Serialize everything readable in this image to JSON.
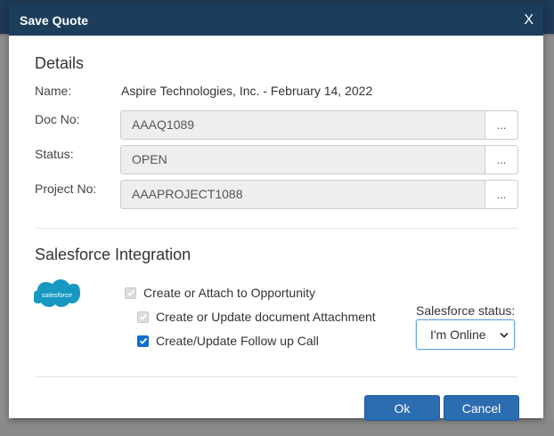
{
  "dialog": {
    "title": "Save Quote",
    "close_label": "X"
  },
  "details": {
    "heading": "Details",
    "name_label": "Name:",
    "name_value": "Aspire Technologies, Inc. - February 14, 2022",
    "doc_label": "Doc No:",
    "doc_value": "AAAQ1089",
    "status_label": "Status:",
    "status_value": "OPEN",
    "project_label": "Project No:",
    "project_value": "AAAPROJECT1088",
    "browse_label": "..."
  },
  "integration": {
    "heading": "Salesforce Integration",
    "logo_text": "salesforce",
    "options": [
      {
        "label": "Create or Attach to Opportunity",
        "checked": true,
        "disabled": true
      },
      {
        "label": "Create or Update document Attachment",
        "checked": true,
        "disabled": true
      },
      {
        "label": "Create/Update Follow up Call",
        "checked": true,
        "disabled": false
      }
    ],
    "status_label": "Salesforce status:",
    "status_selected": "I'm Online"
  },
  "footer": {
    "ok_label": "Ok",
    "cancel_label": "Cancel"
  },
  "colors": {
    "titlebar": "#1d3d5c",
    "primary_button": "#2c6cb0",
    "checkbox_active": "#0f6ecd",
    "salesforce_blue": "#1798c1"
  }
}
